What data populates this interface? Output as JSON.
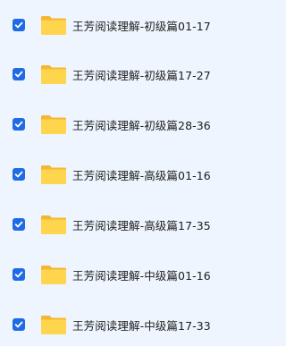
{
  "files": [
    {
      "name": "王芳阅读理解-初级篇01-17",
      "checked": true
    },
    {
      "name": "王芳阅读理解-初级篇17-27",
      "checked": true
    },
    {
      "name": "王芳阅读理解-初级篇28-36",
      "checked": true
    },
    {
      "name": "王芳阅读理解-高级篇01-16",
      "checked": true
    },
    {
      "name": "王芳阅读理解-高级篇17-35",
      "checked": true
    },
    {
      "name": "王芳阅读理解-中级篇01-16",
      "checked": true
    },
    {
      "name": "王芳阅读理解-中级篇17-33",
      "checked": true
    }
  ],
  "colors": {
    "checkbox": "#1f6be6",
    "folder_back": "#f5b731",
    "folder_front": "#ffd54d",
    "background": "#eef5fe"
  },
  "icons": {
    "checkbox": "checkmark-icon",
    "item": "folder-icon"
  }
}
